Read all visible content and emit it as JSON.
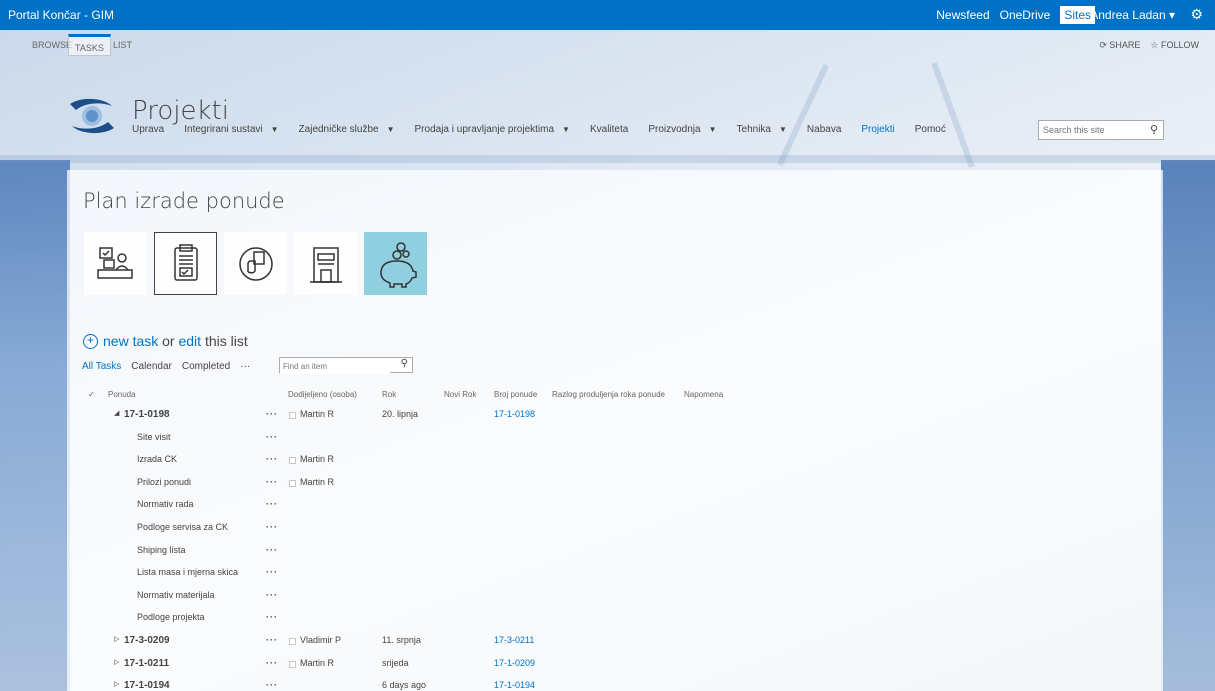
{
  "suitebar": {
    "brand": "Portal Končar - GIM",
    "links": [
      "Newsfeed",
      "OneDrive",
      "Sites"
    ],
    "active_link": "Sites",
    "user": "Andrea Ladan ▾",
    "gear_icon": "gear-icon"
  },
  "ribbon": {
    "tabs": [
      "BROWSE",
      "TASKS",
      "LIST"
    ],
    "share": "SHARE",
    "follow": "FOLLOW"
  },
  "site": {
    "title": "Projekti",
    "nav": [
      {
        "label": "Uprava",
        "caret": false,
        "active": false
      },
      {
        "label": "Integrirani sustavi",
        "caret": true,
        "active": false
      },
      {
        "label": "Zajedničke službe",
        "caret": true,
        "active": false
      },
      {
        "label": "Prodaja i upravljanje projektima",
        "caret": true,
        "active": false
      },
      {
        "label": "Kvaliteta",
        "caret": false,
        "active": false
      },
      {
        "label": "Proizvodnja",
        "caret": true,
        "active": false
      },
      {
        "label": "Tehnika",
        "caret": true,
        "active": false
      },
      {
        "label": "Nabava",
        "caret": false,
        "active": false
      },
      {
        "label": "Projekti",
        "caret": false,
        "active": true
      },
      {
        "label": "Pomoć",
        "caret": false,
        "active": false
      }
    ],
    "search_placeholder": "Search this site"
  },
  "page": {
    "title": "Plan izrade ponude",
    "tiles": [
      "person-desk-icon",
      "clipboard-icon",
      "hand-document-icon",
      "building-icon",
      "piggy-bank-icon"
    ],
    "new_task": {
      "new": "new task",
      "or": " or ",
      "edit": "edit",
      "rest": " this list"
    },
    "views": [
      "All Tasks",
      "Calendar",
      "Completed"
    ],
    "more": "···",
    "find_placeholder": "Find an item"
  },
  "list": {
    "headers": {
      "check": "✓",
      "ponuda": "Ponuda",
      "dodijeljeno": "Dodijeljeno (osoba)",
      "rok": "Rok",
      "novi_rok": "Novi Rok",
      "broj": "Broj ponude",
      "razlog": "Razlog produljenja roka ponude",
      "napomena": "Napomena"
    },
    "rows": [
      {
        "expander": "◢",
        "title": "17-1-0198",
        "group": true,
        "dots": "···",
        "assigned": "Martin R",
        "rok": "20. lipnja",
        "broj": "17-1-0198"
      },
      {
        "title": "Site visit",
        "group": false,
        "dots": "···",
        "assigned": "",
        "rok": "",
        "broj": ""
      },
      {
        "title": "Izrada CK",
        "group": false,
        "dots": "···",
        "assigned": "Martin R",
        "rok": "",
        "broj": ""
      },
      {
        "title": "Prilozi ponudi",
        "group": false,
        "dots": "···",
        "assigned": "Martin R",
        "rok": "",
        "broj": ""
      },
      {
        "title": "Normativ rada",
        "group": false,
        "dots": "···",
        "assigned": "",
        "rok": "",
        "broj": ""
      },
      {
        "title": "Podloge servisa za CK",
        "group": false,
        "dots": "···",
        "assigned": "",
        "rok": "",
        "broj": ""
      },
      {
        "title": "Shiping lista",
        "group": false,
        "dots": "···",
        "assigned": "",
        "rok": "",
        "broj": ""
      },
      {
        "title": "Lista masa i mjerna skica",
        "group": false,
        "dots": "···",
        "assigned": "",
        "rok": "",
        "broj": ""
      },
      {
        "title": "Normativ materijala",
        "group": false,
        "dots": "···",
        "assigned": "",
        "rok": "",
        "broj": ""
      },
      {
        "title": "Podloge projekta",
        "group": false,
        "dots": "···",
        "assigned": "",
        "rok": "",
        "broj": ""
      },
      {
        "expander": "▷",
        "title": "17-3-0209",
        "group": true,
        "dots": "···",
        "assigned": "Vladimir P",
        "rok": "11. srpnja",
        "broj": "17-3-0211"
      },
      {
        "expander": "▷",
        "title": "17-1-0211",
        "group": true,
        "dots": "···",
        "assigned": "Martin R",
        "rok": "srijeda",
        "broj": "17-1-0209"
      },
      {
        "expander": "▷",
        "title": "17-1-0194",
        "group": true,
        "dots": "···",
        "assigned": "",
        "rok": "6 days ago",
        "broj": "17-1-0194"
      }
    ]
  }
}
